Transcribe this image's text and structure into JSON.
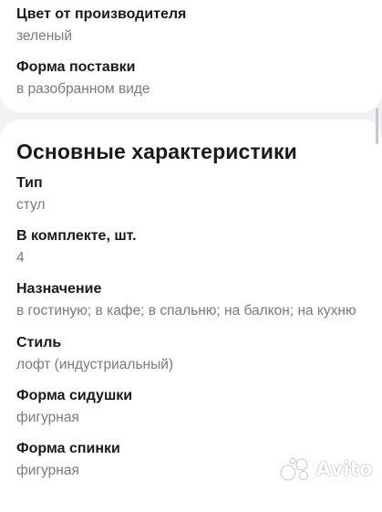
{
  "top_card": {
    "items": [
      {
        "label": "Цвет от производителя",
        "value": "зеленый"
      },
      {
        "label": "Форма поставки",
        "value": "в разобранном виде"
      }
    ]
  },
  "main_card": {
    "title": "Основные характеристики",
    "items": [
      {
        "label": "Тип",
        "value": "стул"
      },
      {
        "label": "В комплекте, шт.",
        "value": "4"
      },
      {
        "label": "Назначение",
        "value": "в гостиную; в кафе; в спальню; на балкон; на кухню"
      },
      {
        "label": "Стиль",
        "value": "лофт (индустриальный)"
      },
      {
        "label": "Форма сидушки",
        "value": "фигурная"
      },
      {
        "label": "Форма спинки",
        "value": "фигурная"
      }
    ]
  },
  "watermark": {
    "text": "Avito"
  },
  "colors": {
    "background": "#f1f1f4",
    "card": "#ffffff",
    "label": "#1a1a1a",
    "value": "#7a7a80"
  }
}
